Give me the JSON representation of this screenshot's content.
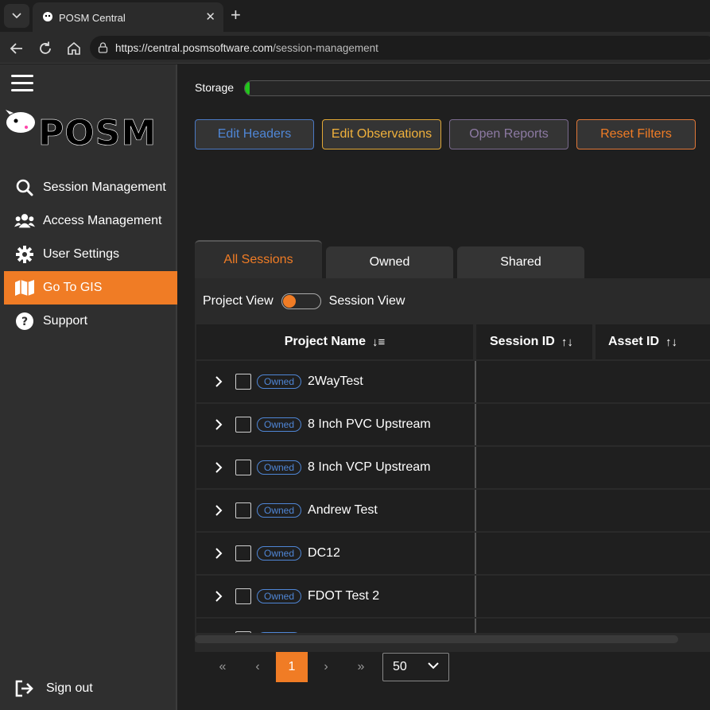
{
  "browser": {
    "tab_title": "POSM Central",
    "url_host": "https://central.posmsoftware.com",
    "url_path": "/session-management"
  },
  "sidebar": {
    "logo_text": "POSM",
    "items": [
      {
        "label": "Session Management",
        "icon": "search-icon",
        "active": false
      },
      {
        "label": "Access Management",
        "icon": "users-icon",
        "active": false
      },
      {
        "label": "User Settings",
        "icon": "gear-icon",
        "active": false
      },
      {
        "label": "Go To GIS",
        "icon": "map-icon",
        "active": true
      },
      {
        "label": "Support",
        "icon": "help-icon",
        "active": false
      }
    ],
    "sign_out": "Sign out"
  },
  "main": {
    "storage_label": "Storage",
    "storage_used_fraction": 0.01,
    "toolbar": {
      "edit_headers": "Edit Headers",
      "edit_observations": "Edit Observations",
      "open_reports": "Open Reports",
      "reset_filters": "Reset Filters"
    },
    "tabs": [
      "All Sessions",
      "Owned",
      "Shared"
    ],
    "active_tab": "All Sessions",
    "view_toggle": {
      "left": "Project View",
      "right": "Session View"
    },
    "columns": [
      "Project Name",
      "Session ID",
      "Asset ID"
    ],
    "rows": [
      {
        "badge": "Owned",
        "name": "2WayTest"
      },
      {
        "badge": "Owned",
        "name": "8 Inch PVC Upstream"
      },
      {
        "badge": "Owned",
        "name": "8 Inch VCP Upstream"
      },
      {
        "badge": "Owned",
        "name": "Andrew Test"
      },
      {
        "badge": "Owned",
        "name": "DC12"
      },
      {
        "badge": "Owned",
        "name": "FDOT Test 2"
      },
      {
        "badge": "Owned",
        "name": ""
      }
    ],
    "pagination": {
      "first": "«",
      "prev": "‹",
      "current": "1",
      "next": "›",
      "last": "»",
      "page_size": "50"
    }
  },
  "colors": {
    "accent": "#f07c25",
    "blue": "#4f86d6",
    "yellow": "#f0b13c",
    "purple": "#8d7aa3",
    "storage": "#22c51c"
  }
}
